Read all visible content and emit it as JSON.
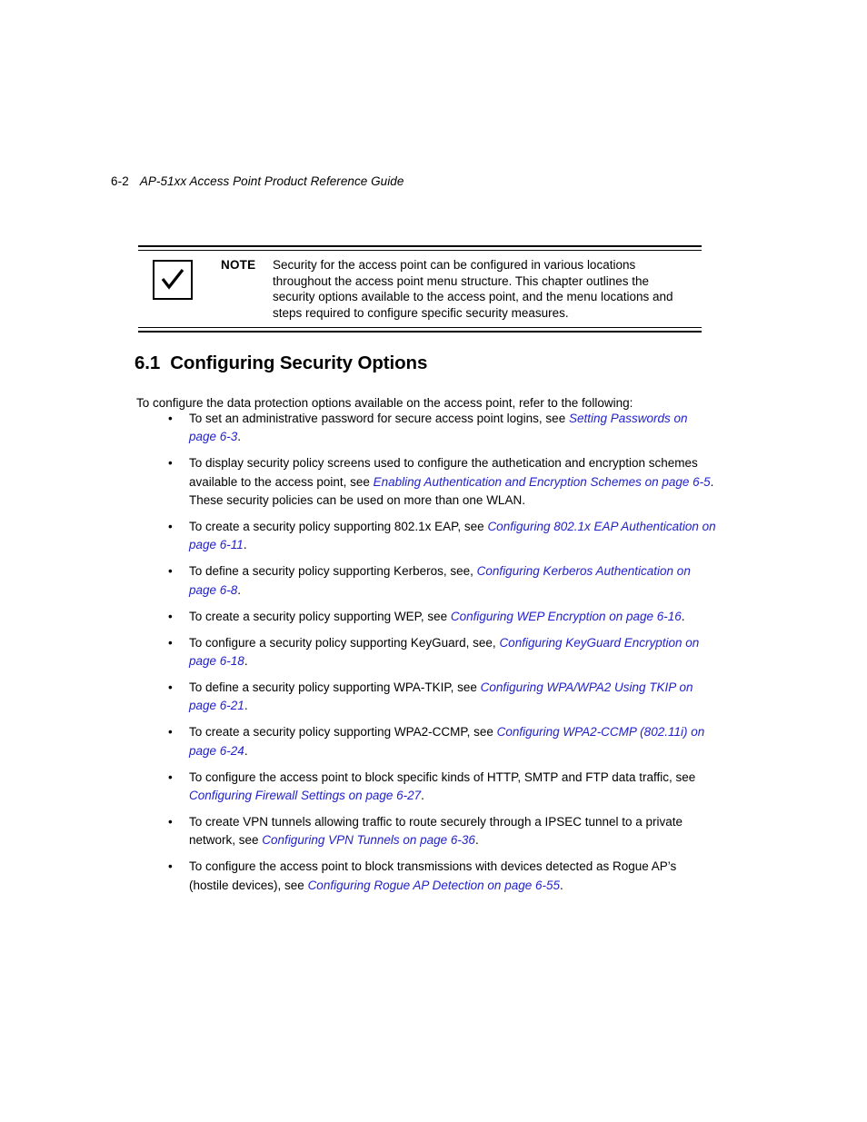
{
  "header": {
    "folio": "6-2",
    "book_title": "AP-51xx Access Point Product Reference Guide"
  },
  "note": {
    "icon": "checkmark-icon",
    "label": "NOTE",
    "text": "Security for the access point can be configured in various locations throughout the access point menu structure. This chapter outlines the security options available to the access point, and the menu locations and steps required to configure specific security measures."
  },
  "section": {
    "number": "6.1",
    "title": "Configuring Security Options"
  },
  "intro": "To configure the data protection options available on the access point, refer to the following:",
  "bullet_marker": "•",
  "link_color": "#2222CC",
  "bullets": [
    {
      "pre": "To set an administrative password for secure access point logins, see ",
      "link": "Setting Passwords on page 6-3",
      "post": "."
    },
    {
      "pre": "To display security policy screens used to configure the authetication and encryption schemes available to the access point, see ",
      "link": "Enabling Authentication and Encryption Schemes on page 6-5",
      "post": ". These security policies can be used on more than one WLAN."
    },
    {
      "pre": "To create a security policy supporting 802.1x EAP, see ",
      "link": "Configuring 802.1x EAP Authentication on page 6-11",
      "post": "."
    },
    {
      "pre": "To define a security policy supporting Kerberos, see, ",
      "link": "Configuring Kerberos Authentication on page 6-8",
      "post": "."
    },
    {
      "pre": "To create a security policy supporting WEP, see ",
      "link": "Configuring WEP Encryption on page 6-16",
      "post": "."
    },
    {
      "pre": "To configure a security policy supporting KeyGuard, see, ",
      "link": "Configuring KeyGuard Encryption on page 6-18",
      "post": "."
    },
    {
      "pre": "To define a security policy supporting WPA-TKIP, see ",
      "link": "Configuring WPA/WPA2 Using TKIP on page 6-21",
      "post": "."
    },
    {
      "pre": "To create a security policy supporting WPA2-CCMP, see ",
      "link": "Configuring WPA2-CCMP (802.11i) on page 6-24",
      "post": "."
    },
    {
      "pre": "To configure the access point to block specific kinds of HTTP, SMTP and FTP data traffic, see ",
      "link": "Configuring Firewall Settings on page 6-27",
      "post": "."
    },
    {
      "pre": "To create VPN tunnels allowing traffic to route securely through a IPSEC tunnel to a private network, see ",
      "link": "Configuring VPN Tunnels on page 6-36",
      "post": "."
    },
    {
      "pre": "To configure the access point to block transmissions with devices detected as Rogue AP’s (hostile devices), see ",
      "link": "Configuring Rogue AP Detection on page 6-55",
      "post": "."
    }
  ]
}
